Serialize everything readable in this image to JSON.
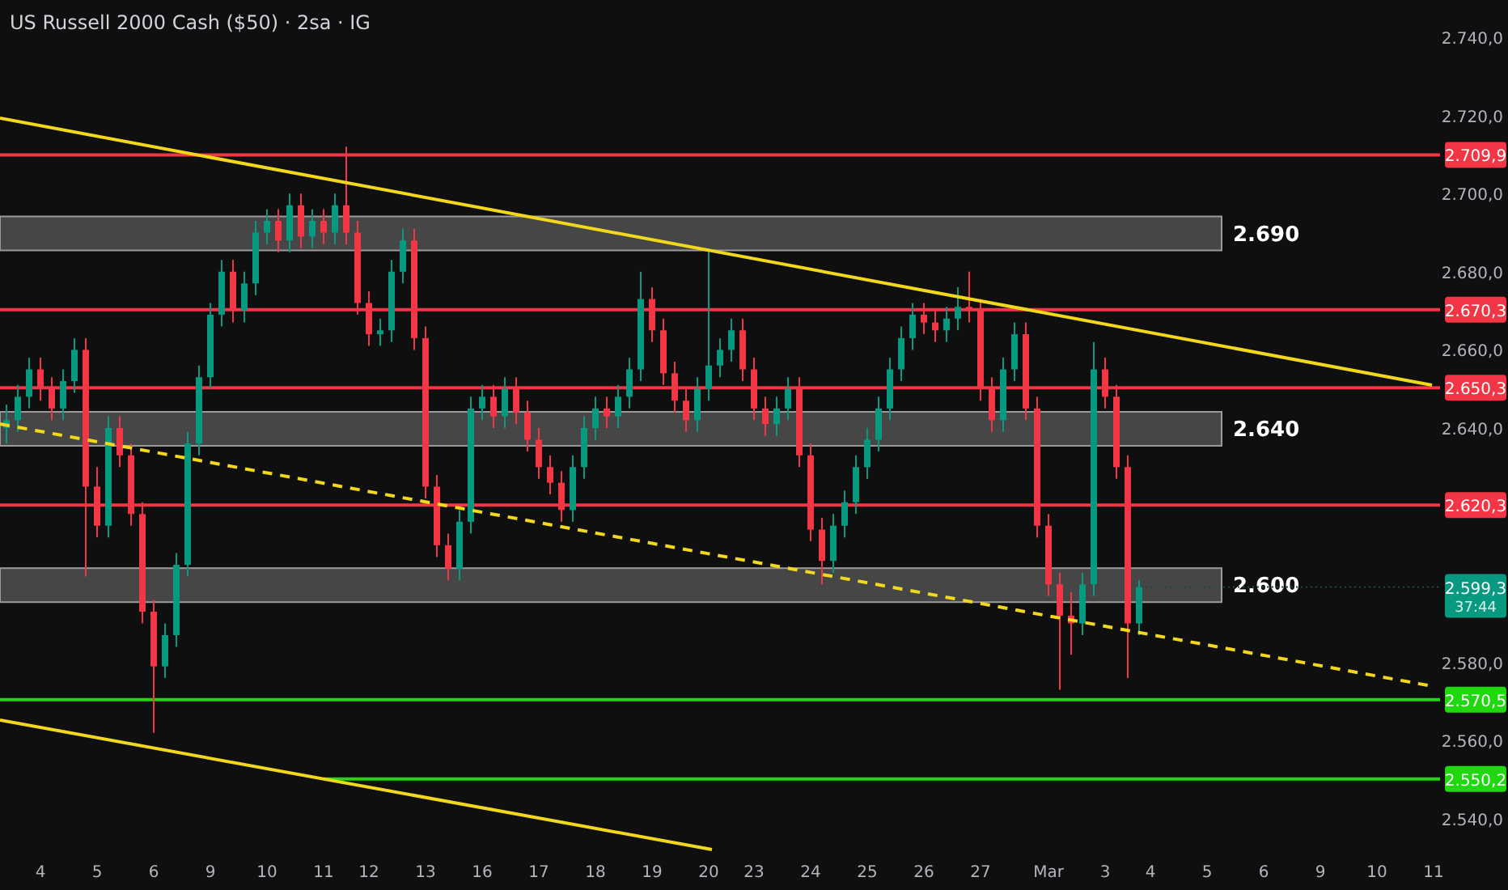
{
  "title": "US Russell 2000 Cash ($50) · 2sa · IG",
  "chart_data": {
    "type": "candlestick",
    "ylim": [
      2540,
      2740
    ],
    "yticks": [
      {
        "value": 2740,
        "label": "2.740,0"
      },
      {
        "value": 2720,
        "label": "2.720,0"
      },
      {
        "value": 2700,
        "label": "2.700,0"
      },
      {
        "value": 2680,
        "label": "2.680,0"
      },
      {
        "value": 2660,
        "label": "2.660,0"
      },
      {
        "value": 2640,
        "label": "2.640,0"
      },
      {
        "value": 2580,
        "label": "2.580,0"
      },
      {
        "value": 2560,
        "label": "2.560,0"
      },
      {
        "value": 2540,
        "label": "2.540,0"
      }
    ],
    "categories": [
      null,
      null,
      null,
      "4",
      null,
      null,
      null,
      null,
      "5",
      null,
      null,
      null,
      null,
      "6",
      null,
      null,
      null,
      null,
      "9",
      null,
      null,
      null,
      null,
      "10",
      null,
      null,
      null,
      null,
      "11",
      null,
      null,
      null,
      "12",
      null,
      null,
      null,
      null,
      "13",
      null,
      null,
      null,
      null,
      "16",
      null,
      null,
      null,
      null,
      "17",
      null,
      null,
      null,
      null,
      "18",
      null,
      null,
      null,
      null,
      "19",
      null,
      null,
      null,
      null,
      "20",
      null,
      null,
      null,
      "23",
      null,
      null,
      null,
      null,
      "24",
      null,
      null,
      null,
      null,
      "25",
      null,
      null,
      null,
      null,
      "26",
      null,
      null,
      null,
      null,
      "27",
      null,
      null,
      null,
      null,
      null,
      "Mar",
      null,
      null,
      null,
      null,
      "3",
      null,
      null,
      null,
      "4",
      null,
      null,
      null,
      null,
      "5",
      null,
      null,
      null,
      null,
      "6",
      null,
      null,
      null,
      null,
      "9",
      null,
      null,
      null,
      null,
      "10",
      null,
      null,
      null,
      null,
      "11"
    ],
    "ohlc": [
      [
        2640,
        2646,
        2636,
        2642
      ],
      [
        2642,
        2651,
        2639,
        2648
      ],
      [
        2648,
        2658,
        2645,
        2655
      ],
      [
        2655,
        2658,
        2647,
        2650
      ],
      [
        2650,
        2653,
        2642,
        2645
      ],
      [
        2645,
        2655,
        2642,
        2652
      ],
      [
        2652,
        2663,
        2649,
        2660
      ],
      [
        2660,
        2663,
        2602,
        2625
      ],
      [
        2625,
        2630,
        2612,
        2615
      ],
      [
        2615,
        2643,
        2612,
        2640
      ],
      [
        2640,
        2643,
        2630,
        2633
      ],
      [
        2633,
        2636,
        2615,
        2618
      ],
      [
        2618,
        2621,
        2590,
        2593
      ],
      [
        2593,
        2596,
        2562,
        2579
      ],
      [
        2579,
        2590,
        2576,
        2587
      ],
      [
        2587,
        2608,
        2584,
        2605
      ],
      [
        2605,
        2639,
        2602,
        2636
      ],
      [
        2636,
        2656,
        2633,
        2653
      ],
      [
        2653,
        2672,
        2650,
        2669
      ],
      [
        2669,
        2683,
        2666,
        2680
      ],
      [
        2680,
        2683,
        2667,
        2670
      ],
      [
        2670,
        2680,
        2667,
        2677
      ],
      [
        2677,
        2693,
        2674,
        2690
      ],
      [
        2690,
        2696,
        2687,
        2693
      ],
      [
        2693,
        2696,
        2685,
        2688
      ],
      [
        2688,
        2700,
        2685,
        2697
      ],
      [
        2697,
        2700,
        2686,
        2689
      ],
      [
        2689,
        2696,
        2686,
        2693
      ],
      [
        2693,
        2696,
        2687,
        2690
      ],
      [
        2690,
        2700,
        2687,
        2697
      ],
      [
        2697,
        2712,
        2687,
        2690
      ],
      [
        2690,
        2693,
        2669,
        2672
      ],
      [
        2672,
        2675,
        2661,
        2664
      ],
      [
        2664,
        2668,
        2661,
        2665
      ],
      [
        2665,
        2683,
        2662,
        2680
      ],
      [
        2680,
        2691,
        2677,
        2688
      ],
      [
        2688,
        2691,
        2660,
        2663
      ],
      [
        2663,
        2666,
        2622,
        2625
      ],
      [
        2625,
        2628,
        2607,
        2610
      ],
      [
        2610,
        2613,
        2601,
        2604
      ],
      [
        2604,
        2619,
        2601,
        2616
      ],
      [
        2616,
        2648,
        2613,
        2645
      ],
      [
        2645,
        2651,
        2642,
        2648
      ],
      [
        2648,
        2651,
        2640,
        2643
      ],
      [
        2643,
        2653,
        2640,
        2650
      ],
      [
        2650,
        2653,
        2641,
        2644
      ],
      [
        2644,
        2647,
        2634,
        2637
      ],
      [
        2637,
        2640,
        2627,
        2630
      ],
      [
        2630,
        2633,
        2623,
        2626
      ],
      [
        2626,
        2629,
        2616,
        2619
      ],
      [
        2619,
        2633,
        2616,
        2630
      ],
      [
        2630,
        2643,
        2627,
        2640
      ],
      [
        2640,
        2648,
        2637,
        2645
      ],
      [
        2645,
        2648,
        2640,
        2643
      ],
      [
        2643,
        2651,
        2640,
        2648
      ],
      [
        2648,
        2658,
        2645,
        2655
      ],
      [
        2655,
        2680,
        2652,
        2673
      ],
      [
        2673,
        2676,
        2662,
        2665
      ],
      [
        2665,
        2668,
        2651,
        2654
      ],
      [
        2654,
        2657,
        2644,
        2647
      ],
      [
        2647,
        2650,
        2639,
        2642
      ],
      [
        2642,
        2653,
        2639,
        2650
      ],
      [
        2650,
        2686,
        2647,
        2656
      ],
      [
        2656,
        2663,
        2653,
        2660
      ],
      [
        2660,
        2668,
        2657,
        2665
      ],
      [
        2665,
        2668,
        2652,
        2655
      ],
      [
        2655,
        2658,
        2642,
        2645
      ],
      [
        2645,
        2648,
        2638,
        2641
      ],
      [
        2641,
        2648,
        2638,
        2645
      ],
      [
        2645,
        2653,
        2642,
        2650
      ],
      [
        2650,
        2653,
        2630,
        2633
      ],
      [
        2633,
        2636,
        2611,
        2614
      ],
      [
        2614,
        2617,
        2600,
        2606
      ],
      [
        2606,
        2618,
        2603,
        2615
      ],
      [
        2615,
        2624,
        2612,
        2621
      ],
      [
        2621,
        2633,
        2618,
        2630
      ],
      [
        2630,
        2640,
        2627,
        2637
      ],
      [
        2637,
        2648,
        2634,
        2645
      ],
      [
        2645,
        2658,
        2642,
        2655
      ],
      [
        2655,
        2666,
        2652,
        2663
      ],
      [
        2663,
        2672,
        2660,
        2669
      ],
      [
        2669,
        2672,
        2664,
        2667
      ],
      [
        2667,
        2670,
        2662,
        2665
      ],
      [
        2665,
        2671,
        2662,
        2668
      ],
      [
        2668,
        2676,
        2665,
        2671
      ],
      [
        2671,
        2680,
        2667,
        2670
      ],
      [
        2670,
        2673,
        2647,
        2650
      ],
      [
        2650,
        2653,
        2639,
        2642
      ],
      [
        2642,
        2658,
        2639,
        2655
      ],
      [
        2655,
        2667,
        2652,
        2664
      ],
      [
        2664,
        2667,
        2642,
        2645
      ],
      [
        2645,
        2648,
        2612,
        2615
      ],
      [
        2615,
        2618,
        2597,
        2600
      ],
      [
        2600,
        2603,
        2573,
        2592
      ],
      [
        2592,
        2598,
        2582,
        2590
      ],
      [
        2590,
        2603,
        2587,
        2600
      ],
      [
        2600,
        2662,
        2597,
        2655
      ],
      [
        2655,
        2658,
        2645,
        2648
      ],
      [
        2648,
        2651,
        2627,
        2630
      ],
      [
        2630,
        2633,
        2576,
        2590
      ],
      [
        2590,
        2601,
        2587,
        2599.3
      ],
      null,
      null,
      null,
      null,
      null,
      null,
      null,
      null,
      null,
      null,
      null,
      null,
      null,
      null,
      null,
      null,
      null,
      null,
      null,
      null,
      null,
      null,
      null,
      null,
      null,
      null
    ]
  },
  "levels": [
    {
      "label": "2.709,9",
      "color": "#f23645"
    },
    {
      "label": "2.670,3",
      "color": "#f23645"
    },
    {
      "label": "2.650,3",
      "color": "#f23645"
    },
    {
      "label": "2.620,3",
      "color": "#f23645"
    },
    {
      "label": "2.570,5",
      "color": "#1fd80e"
    },
    {
      "label": "2.550,2",
      "color": "#1fd80e"
    }
  ],
  "zones": [
    {
      "label": "2.690"
    },
    {
      "label": "2.640"
    },
    {
      "label": "2.600"
    }
  ],
  "current_price": {
    "price": "2.599,3",
    "countdown": "37:44"
  }
}
